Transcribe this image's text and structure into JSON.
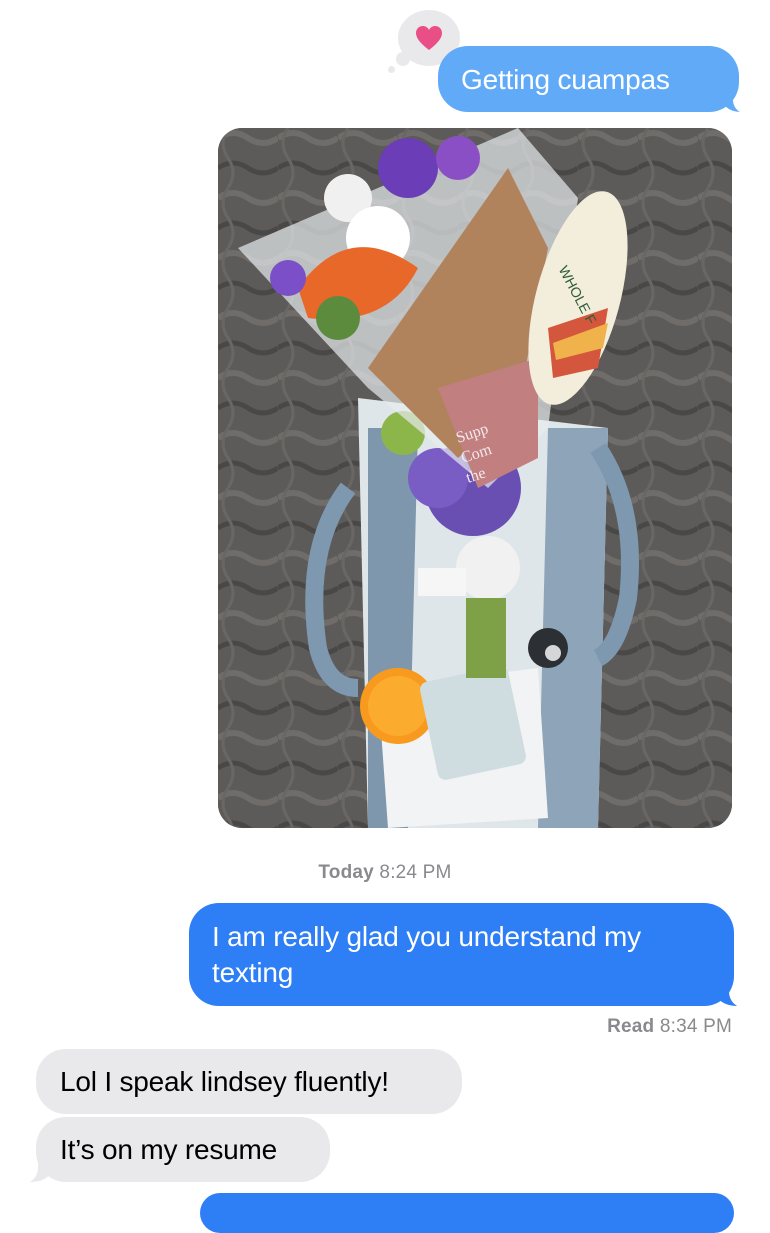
{
  "messages": [
    {
      "id": "m1",
      "direction": "sent",
      "text": "Getting cuampas",
      "reaction": "heart"
    },
    {
      "id": "m2",
      "direction": "sent",
      "type": "photo"
    },
    {
      "id": "m3",
      "direction": "sent",
      "text": "I am really glad you understand my texting"
    },
    {
      "id": "m4",
      "direction": "received",
      "text": "Lol I speak lindsey fluently!"
    },
    {
      "id": "m5",
      "direction": "received",
      "text": "It’s on my resume"
    }
  ],
  "timestamp": {
    "day": "Today",
    "time": "8:24 PM"
  },
  "read_receipt": {
    "label": "Read",
    "time": "8:34 PM"
  },
  "photo": {
    "tag_text_1": "Supp",
    "tag_text_2": "Com",
    "tag_text_3": "the",
    "sticker_text": "WHOLE F"
  },
  "colors": {
    "sent_bubble": "#2e7ef6",
    "sent_bubble_pending": "#61aaf8",
    "received_bubble": "#e9e9eb",
    "heart": "#ea4e86"
  }
}
